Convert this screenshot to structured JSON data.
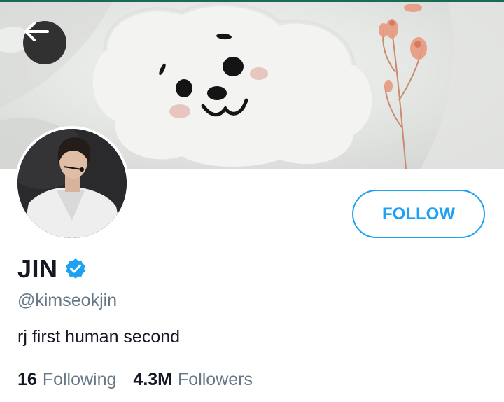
{
  "profile": {
    "name": "JIN",
    "handle": "@kimseokjin",
    "bio": "rj first human second",
    "verified": true
  },
  "actions": {
    "follow_label": "FOLLOW"
  },
  "stats": {
    "following_count": "16",
    "following_label": "Following",
    "followers_count": "4.3M",
    "followers_label": "Followers"
  },
  "icons": {
    "back": "arrow-left-icon",
    "verified": "verified-badge-icon"
  },
  "colors": {
    "accent": "#1da1f2",
    "text_primary": "#141823",
    "text_secondary": "#657786",
    "top_strip": "#1a6a55"
  }
}
